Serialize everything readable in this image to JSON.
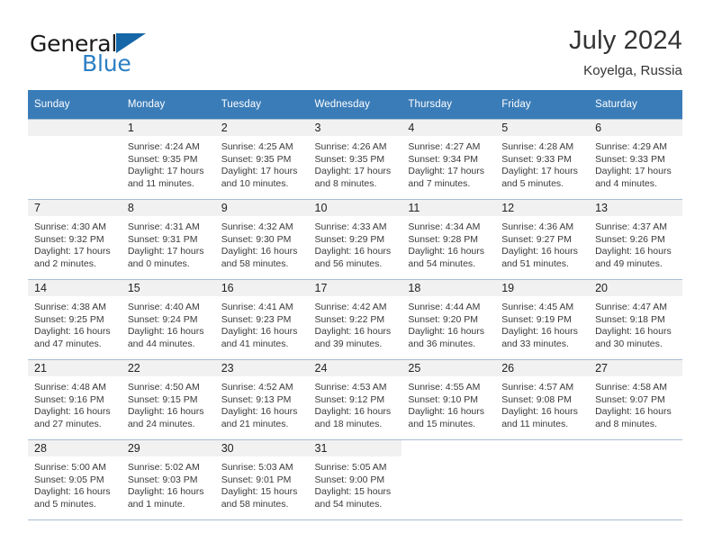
{
  "brand": {
    "name_part1": "General",
    "name_part2": "Blue",
    "logo_icon": "triangle-flag-icon"
  },
  "header": {
    "title": "July 2024",
    "subtitle": "Koyelga, Russia"
  },
  "colors": {
    "header_row_bg": "#3a7cb8",
    "day_number_bg": "#f1f1f1",
    "brand_blue": "#2b7fc4",
    "logo_triangle": "#1567a8",
    "grid_line": "#a9bdd2",
    "text": "#333333"
  },
  "weekday_headers": [
    "Sunday",
    "Monday",
    "Tuesday",
    "Wednesday",
    "Thursday",
    "Friday",
    "Saturday"
  ],
  "labels": {
    "sunrise": "Sunrise:",
    "sunset": "Sunset:",
    "daylight": "Daylight:"
  },
  "weeks": [
    [
      {
        "day": "",
        "empty": true,
        "sunrise": "",
        "sunset": "",
        "daylight_line1": "",
        "daylight_line2": ""
      },
      {
        "day": "1",
        "sunrise": "Sunrise: 4:24 AM",
        "sunset": "Sunset: 9:35 PM",
        "daylight_line1": "Daylight: 17 hours",
        "daylight_line2": "and 11 minutes."
      },
      {
        "day": "2",
        "sunrise": "Sunrise: 4:25 AM",
        "sunset": "Sunset: 9:35 PM",
        "daylight_line1": "Daylight: 17 hours",
        "daylight_line2": "and 10 minutes."
      },
      {
        "day": "3",
        "sunrise": "Sunrise: 4:26 AM",
        "sunset": "Sunset: 9:35 PM",
        "daylight_line1": "Daylight: 17 hours",
        "daylight_line2": "and 8 minutes."
      },
      {
        "day": "4",
        "sunrise": "Sunrise: 4:27 AM",
        "sunset": "Sunset: 9:34 PM",
        "daylight_line1": "Daylight: 17 hours",
        "daylight_line2": "and 7 minutes."
      },
      {
        "day": "5",
        "sunrise": "Sunrise: 4:28 AM",
        "sunset": "Sunset: 9:33 PM",
        "daylight_line1": "Daylight: 17 hours",
        "daylight_line2": "and 5 minutes."
      },
      {
        "day": "6",
        "sunrise": "Sunrise: 4:29 AM",
        "sunset": "Sunset: 9:33 PM",
        "daylight_line1": "Daylight: 17 hours",
        "daylight_line2": "and 4 minutes."
      }
    ],
    [
      {
        "day": "7",
        "sunrise": "Sunrise: 4:30 AM",
        "sunset": "Sunset: 9:32 PM",
        "daylight_line1": "Daylight: 17 hours",
        "daylight_line2": "and 2 minutes."
      },
      {
        "day": "8",
        "sunrise": "Sunrise: 4:31 AM",
        "sunset": "Sunset: 9:31 PM",
        "daylight_line1": "Daylight: 17 hours",
        "daylight_line2": "and 0 minutes."
      },
      {
        "day": "9",
        "sunrise": "Sunrise: 4:32 AM",
        "sunset": "Sunset: 9:30 PM",
        "daylight_line1": "Daylight: 16 hours",
        "daylight_line2": "and 58 minutes."
      },
      {
        "day": "10",
        "sunrise": "Sunrise: 4:33 AM",
        "sunset": "Sunset: 9:29 PM",
        "daylight_line1": "Daylight: 16 hours",
        "daylight_line2": "and 56 minutes."
      },
      {
        "day": "11",
        "sunrise": "Sunrise: 4:34 AM",
        "sunset": "Sunset: 9:28 PM",
        "daylight_line1": "Daylight: 16 hours",
        "daylight_line2": "and 54 minutes."
      },
      {
        "day": "12",
        "sunrise": "Sunrise: 4:36 AM",
        "sunset": "Sunset: 9:27 PM",
        "daylight_line1": "Daylight: 16 hours",
        "daylight_line2": "and 51 minutes."
      },
      {
        "day": "13",
        "sunrise": "Sunrise: 4:37 AM",
        "sunset": "Sunset: 9:26 PM",
        "daylight_line1": "Daylight: 16 hours",
        "daylight_line2": "and 49 minutes."
      }
    ],
    [
      {
        "day": "14",
        "sunrise": "Sunrise: 4:38 AM",
        "sunset": "Sunset: 9:25 PM",
        "daylight_line1": "Daylight: 16 hours",
        "daylight_line2": "and 47 minutes."
      },
      {
        "day": "15",
        "sunrise": "Sunrise: 4:40 AM",
        "sunset": "Sunset: 9:24 PM",
        "daylight_line1": "Daylight: 16 hours",
        "daylight_line2": "and 44 minutes."
      },
      {
        "day": "16",
        "sunrise": "Sunrise: 4:41 AM",
        "sunset": "Sunset: 9:23 PM",
        "daylight_line1": "Daylight: 16 hours",
        "daylight_line2": "and 41 minutes."
      },
      {
        "day": "17",
        "sunrise": "Sunrise: 4:42 AM",
        "sunset": "Sunset: 9:22 PM",
        "daylight_line1": "Daylight: 16 hours",
        "daylight_line2": "and 39 minutes."
      },
      {
        "day": "18",
        "sunrise": "Sunrise: 4:44 AM",
        "sunset": "Sunset: 9:20 PM",
        "daylight_line1": "Daylight: 16 hours",
        "daylight_line2": "and 36 minutes."
      },
      {
        "day": "19",
        "sunrise": "Sunrise: 4:45 AM",
        "sunset": "Sunset: 9:19 PM",
        "daylight_line1": "Daylight: 16 hours",
        "daylight_line2": "and 33 minutes."
      },
      {
        "day": "20",
        "sunrise": "Sunrise: 4:47 AM",
        "sunset": "Sunset: 9:18 PM",
        "daylight_line1": "Daylight: 16 hours",
        "daylight_line2": "and 30 minutes."
      }
    ],
    [
      {
        "day": "21",
        "sunrise": "Sunrise: 4:48 AM",
        "sunset": "Sunset: 9:16 PM",
        "daylight_line1": "Daylight: 16 hours",
        "daylight_line2": "and 27 minutes."
      },
      {
        "day": "22",
        "sunrise": "Sunrise: 4:50 AM",
        "sunset": "Sunset: 9:15 PM",
        "daylight_line1": "Daylight: 16 hours",
        "daylight_line2": "and 24 minutes."
      },
      {
        "day": "23",
        "sunrise": "Sunrise: 4:52 AM",
        "sunset": "Sunset: 9:13 PM",
        "daylight_line1": "Daylight: 16 hours",
        "daylight_line2": "and 21 minutes."
      },
      {
        "day": "24",
        "sunrise": "Sunrise: 4:53 AM",
        "sunset": "Sunset: 9:12 PM",
        "daylight_line1": "Daylight: 16 hours",
        "daylight_line2": "and 18 minutes."
      },
      {
        "day": "25",
        "sunrise": "Sunrise: 4:55 AM",
        "sunset": "Sunset: 9:10 PM",
        "daylight_line1": "Daylight: 16 hours",
        "daylight_line2": "and 15 minutes."
      },
      {
        "day": "26",
        "sunrise": "Sunrise: 4:57 AM",
        "sunset": "Sunset: 9:08 PM",
        "daylight_line1": "Daylight: 16 hours",
        "daylight_line2": "and 11 minutes."
      },
      {
        "day": "27",
        "sunrise": "Sunrise: 4:58 AM",
        "sunset": "Sunset: 9:07 PM",
        "daylight_line1": "Daylight: 16 hours",
        "daylight_line2": "and 8 minutes."
      }
    ],
    [
      {
        "day": "28",
        "sunrise": "Sunrise: 5:00 AM",
        "sunset": "Sunset: 9:05 PM",
        "daylight_line1": "Daylight: 16 hours",
        "daylight_line2": "and 5 minutes."
      },
      {
        "day": "29",
        "sunrise": "Sunrise: 5:02 AM",
        "sunset": "Sunset: 9:03 PM",
        "daylight_line1": "Daylight: 16 hours",
        "daylight_line2": "and 1 minute."
      },
      {
        "day": "30",
        "sunrise": "Sunrise: 5:03 AM",
        "sunset": "Sunset: 9:01 PM",
        "daylight_line1": "Daylight: 15 hours",
        "daylight_line2": "and 58 minutes."
      },
      {
        "day": "31",
        "sunrise": "Sunrise: 5:05 AM",
        "sunset": "Sunset: 9:00 PM",
        "daylight_line1": "Daylight: 15 hours",
        "daylight_line2": "and 54 minutes."
      },
      {
        "day": "",
        "blank": true,
        "sunrise": "",
        "sunset": "",
        "daylight_line1": "",
        "daylight_line2": ""
      },
      {
        "day": "",
        "blank": true,
        "sunrise": "",
        "sunset": "",
        "daylight_line1": "",
        "daylight_line2": ""
      },
      {
        "day": "",
        "blank": true,
        "sunrise": "",
        "sunset": "",
        "daylight_line1": "",
        "daylight_line2": ""
      }
    ]
  ]
}
